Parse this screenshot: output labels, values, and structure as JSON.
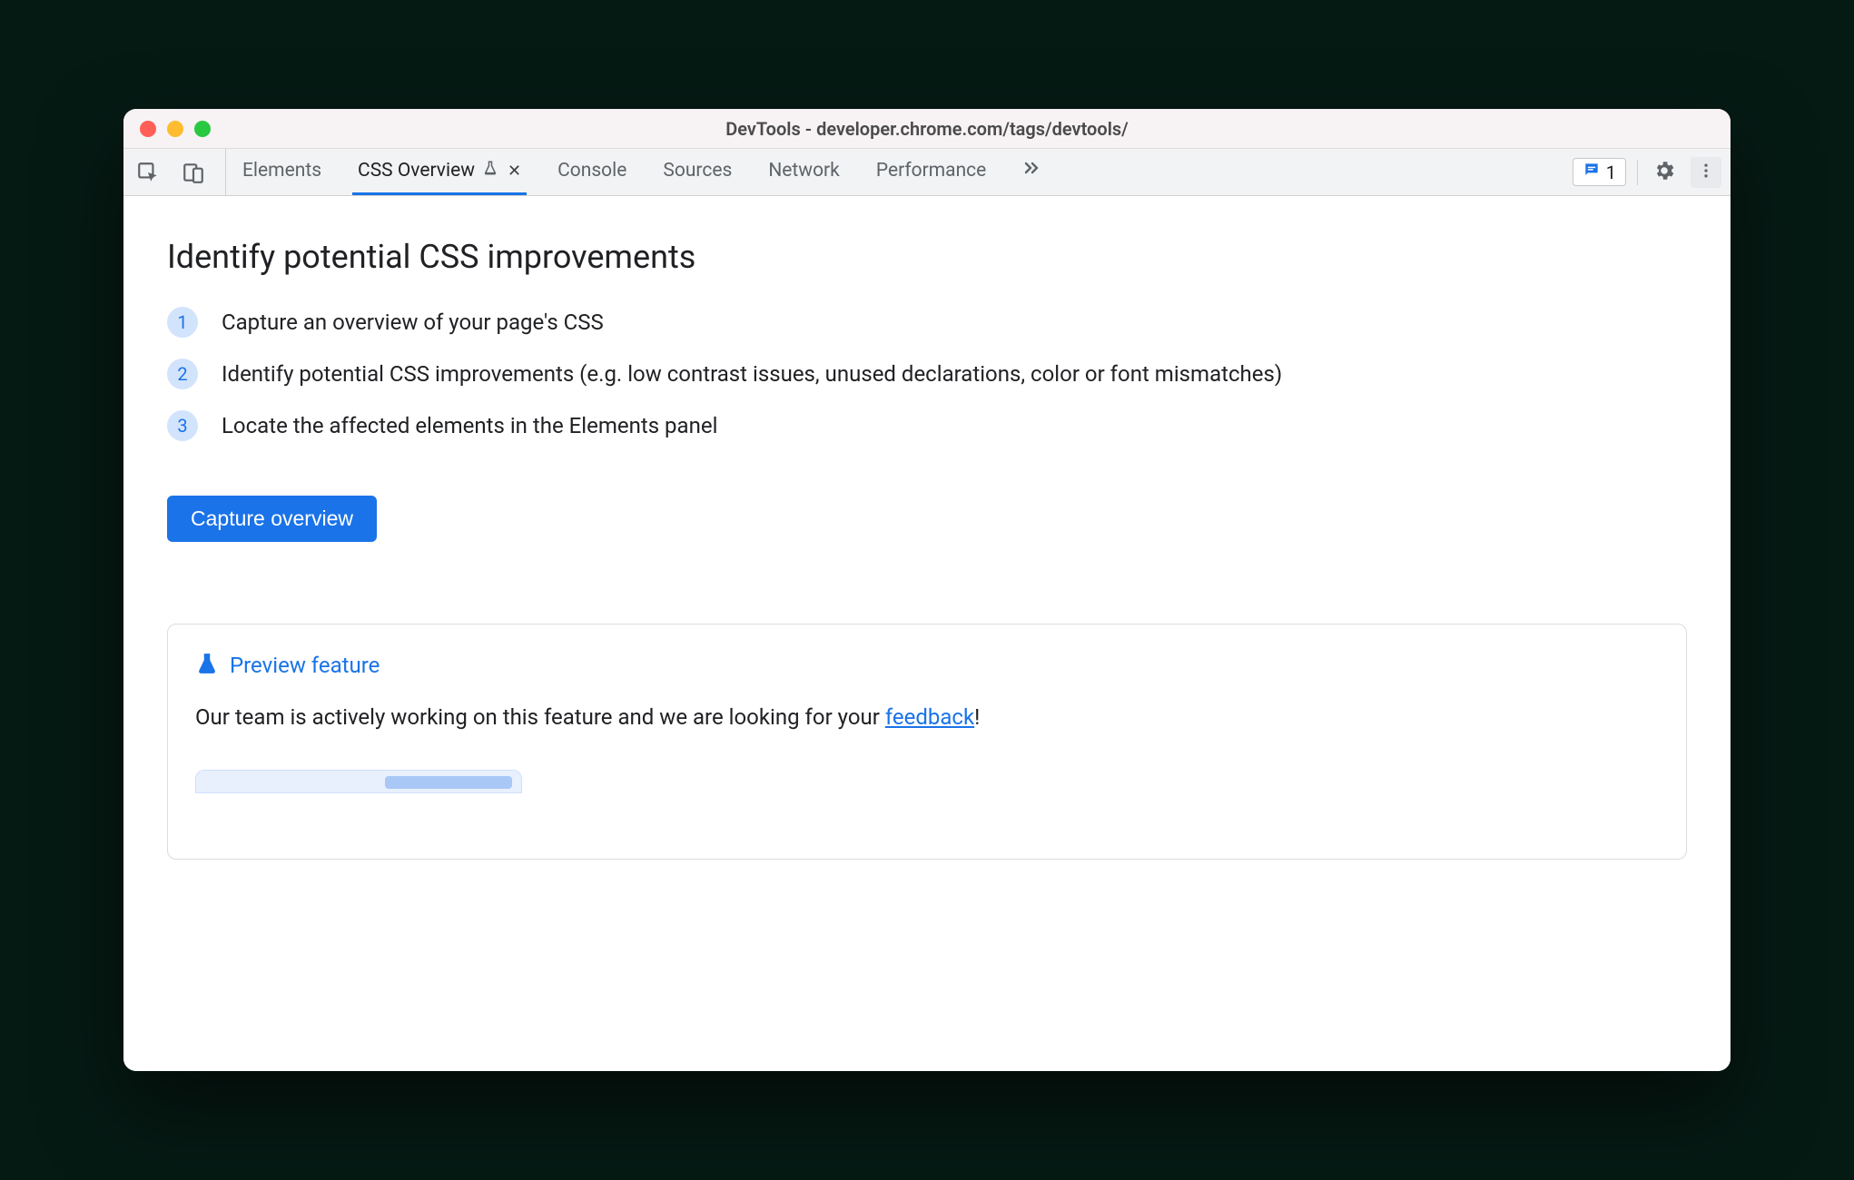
{
  "window": {
    "title": "DevTools - developer.chrome.com/tags/devtools/"
  },
  "toolbar": {
    "tabs": [
      {
        "label": "Elements"
      },
      {
        "label": "CSS Overview"
      },
      {
        "label": "Console"
      },
      {
        "label": "Sources"
      },
      {
        "label": "Network"
      },
      {
        "label": "Performance"
      }
    ],
    "issues_count": "1"
  },
  "panel": {
    "heading": "Identify potential CSS improvements",
    "steps": [
      "Capture an overview of your page's CSS",
      "Identify potential CSS improvements (e.g. low contrast issues, unused declarations, color or font mismatches)",
      "Locate the affected elements in the Elements panel"
    ],
    "step_numbers": [
      "1",
      "2",
      "3"
    ],
    "capture_button": "Capture overview"
  },
  "preview": {
    "title": "Preview feature",
    "body_before": "Our team is actively working on this feature and we are looking for your ",
    "feedback_link": "feedback",
    "body_after": "!"
  }
}
